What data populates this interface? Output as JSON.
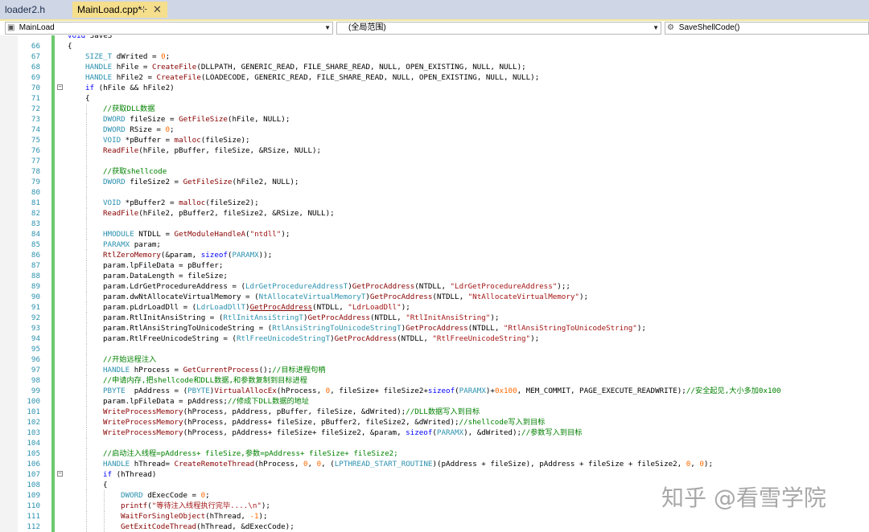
{
  "tabs": {
    "inactive_label": "loader2.h",
    "active_label": "MainLoad.cpp*",
    "pin_icon": "pin-icon",
    "close_icon": "close-icon"
  },
  "nav": {
    "scope_label": "MainLoad",
    "range_label": "(全局范围)",
    "member_label": "SaveShellCode()"
  },
  "colors": {
    "keyword": "#0000ff",
    "type": "#2b91af",
    "function": "#880000",
    "comment": "#008000",
    "string": "#a31515",
    "macro": "#6f008a",
    "number": "#ff6a00",
    "cast": "#2b91af"
  },
  "watermark": "知乎 @看雪学院",
  "lines": [
    {
      "n": "",
      "fold": "",
      "indent": 0,
      "tokens": [
        [
          "k",
          "void"
        ],
        [
          "p",
          " SaveS"
        ]
      ]
    },
    {
      "n": "66",
      "fold": "",
      "indent": 0,
      "tokens": [
        [
          "p",
          "{"
        ]
      ]
    },
    {
      "n": "67",
      "fold": "",
      "indent": 1,
      "tokens": [
        [
          "t",
          "SIZE_T"
        ],
        [
          "p",
          " dWrited = "
        ],
        [
          "num",
          "0"
        ],
        [
          "p",
          ";"
        ]
      ]
    },
    {
      "n": "68",
      "fold": "",
      "indent": 1,
      "tokens": [
        [
          "t",
          "HANDLE"
        ],
        [
          "p",
          " hFile = "
        ],
        [
          "f",
          "CreateFile"
        ],
        [
          "p",
          "(DLLPATH, GENERIC_READ, FILE_SHARE_READ, NULL, OPEN_EXISTING, NULL, NULL);"
        ]
      ]
    },
    {
      "n": "69",
      "fold": "",
      "indent": 1,
      "tokens": [
        [
          "t",
          "HANDLE"
        ],
        [
          "p",
          " hFile2 = "
        ],
        [
          "f",
          "CreateFile"
        ],
        [
          "p",
          "(LOADECODE, GENERIC_READ, FILE_SHARE_READ, NULL, OPEN_EXISTING, NULL, NULL);"
        ]
      ]
    },
    {
      "n": "70",
      "fold": "−",
      "indent": 1,
      "tokens": [
        [
          "k",
          "if"
        ],
        [
          "p",
          " (hFile && hFile2)"
        ]
      ]
    },
    {
      "n": "71",
      "fold": "",
      "indent": 1,
      "tokens": [
        [
          "p",
          "{"
        ]
      ]
    },
    {
      "n": "72",
      "fold": "",
      "indent": 2,
      "tokens": [
        [
          "c",
          "//获取DLL数据"
        ]
      ]
    },
    {
      "n": "73",
      "fold": "",
      "indent": 2,
      "tokens": [
        [
          "t",
          "DWORD"
        ],
        [
          "p",
          " fileSize = "
        ],
        [
          "f",
          "GetFileSize"
        ],
        [
          "p",
          "(hFile, NULL);"
        ]
      ]
    },
    {
      "n": "74",
      "fold": "",
      "indent": 2,
      "tokens": [
        [
          "t",
          "DWORD"
        ],
        [
          "p",
          " RSize = "
        ],
        [
          "num",
          "0"
        ],
        [
          "p",
          ";"
        ]
      ]
    },
    {
      "n": "75",
      "fold": "",
      "indent": 2,
      "tokens": [
        [
          "t",
          "VOID"
        ],
        [
          "p",
          " *pBuffer = "
        ],
        [
          "f",
          "malloc"
        ],
        [
          "p",
          "(fileSize);"
        ]
      ]
    },
    {
      "n": "76",
      "fold": "",
      "indent": 2,
      "tokens": [
        [
          "f",
          "ReadFile"
        ],
        [
          "p",
          "(hFile, pBuffer, fileSize, &RSize, NULL);"
        ]
      ]
    },
    {
      "n": "77",
      "fold": "",
      "indent": 2,
      "tokens": []
    },
    {
      "n": "78",
      "fold": "",
      "indent": 2,
      "tokens": [
        [
          "c",
          "//获取shellcode"
        ]
      ]
    },
    {
      "n": "79",
      "fold": "",
      "indent": 2,
      "tokens": [
        [
          "t",
          "DWORD"
        ],
        [
          "p",
          " fileSize2 = "
        ],
        [
          "f",
          "GetFileSize"
        ],
        [
          "p",
          "(hFile2, NULL);"
        ]
      ]
    },
    {
      "n": "80",
      "fold": "",
      "indent": 2,
      "tokens": []
    },
    {
      "n": "81",
      "fold": "",
      "indent": 2,
      "tokens": [
        [
          "t",
          "VOID"
        ],
        [
          "p",
          " *pBuffer2 = "
        ],
        [
          "f",
          "malloc"
        ],
        [
          "p",
          "(fileSize2);"
        ]
      ]
    },
    {
      "n": "82",
      "fold": "",
      "indent": 2,
      "tokens": [
        [
          "f",
          "ReadFile"
        ],
        [
          "p",
          "(hFile2, pBuffer2, fileSize2, &RSize, NULL);"
        ]
      ]
    },
    {
      "n": "83",
      "fold": "",
      "indent": 2,
      "tokens": []
    },
    {
      "n": "84",
      "fold": "",
      "indent": 2,
      "tokens": [
        [
          "t",
          "HMODULE"
        ],
        [
          "p",
          " NTDLL = "
        ],
        [
          "f",
          "GetModuleHandleA"
        ],
        [
          "p",
          "("
        ],
        [
          "s",
          "\"ntdll\""
        ],
        [
          "p",
          ");"
        ]
      ]
    },
    {
      "n": "85",
      "fold": "",
      "indent": 2,
      "tokens": [
        [
          "t",
          "PARAMX"
        ],
        [
          "p",
          " param;"
        ]
      ]
    },
    {
      "n": "86",
      "fold": "",
      "indent": 2,
      "tokens": [
        [
          "f",
          "RtlZeroMemory"
        ],
        [
          "p",
          "(&param, "
        ],
        [
          "k",
          "sizeof"
        ],
        [
          "p",
          "("
        ],
        [
          "t",
          "PARAMX"
        ],
        [
          "p",
          "));"
        ]
      ]
    },
    {
      "n": "87",
      "fold": "",
      "indent": 2,
      "tokens": [
        [
          "p",
          "param.lpFileData = pBuffer;"
        ]
      ]
    },
    {
      "n": "88",
      "fold": "",
      "indent": 2,
      "tokens": [
        [
          "p",
          "param.DataLength = fileSize;"
        ]
      ]
    },
    {
      "n": "89",
      "fold": "",
      "indent": 2,
      "tokens": [
        [
          "p",
          "param.LdrGetProcedureAddress = ("
        ],
        [
          "t",
          "LdrGetProcedureAddressT"
        ],
        [
          "p",
          ")"
        ],
        [
          "f",
          "GetProcAddress"
        ],
        [
          "p",
          "(NTDLL, "
        ],
        [
          "s",
          "\"LdrGetProcedureAddress\""
        ],
        [
          "p",
          ");;"
        ]
      ]
    },
    {
      "n": "90",
      "fold": "",
      "indent": 2,
      "tokens": [
        [
          "p",
          "param.dwNtAllocateVirtualMemory = ("
        ],
        [
          "t",
          "NtAllocateVirtualMemoryT"
        ],
        [
          "p",
          ")"
        ],
        [
          "f",
          "GetProcAddress"
        ],
        [
          "p",
          "(NTDLL, "
        ],
        [
          "s",
          "\"NtAllocateVirtualMemory\""
        ],
        [
          "p",
          ");"
        ]
      ]
    },
    {
      "n": "91",
      "fold": "",
      "indent": 2,
      "tokens": [
        [
          "p",
          "param.pLdrLoadDll = ("
        ],
        [
          "t",
          "LdrLoadDllT"
        ],
        [
          "p",
          ")"
        ],
        [
          "u",
          "GetProcAddress"
        ],
        [
          "p",
          "(NTDLL, "
        ],
        [
          "s",
          "\"LdrLoadDll\""
        ],
        [
          "p",
          ");"
        ]
      ]
    },
    {
      "n": "92",
      "fold": "",
      "indent": 2,
      "tokens": [
        [
          "p",
          "param.RtlInitAnsiString = ("
        ],
        [
          "t",
          "RtlInitAnsiStringT"
        ],
        [
          "p",
          ")"
        ],
        [
          "f",
          "GetProcAddress"
        ],
        [
          "p",
          "(NTDLL, "
        ],
        [
          "s",
          "\"RtlInitAnsiString\""
        ],
        [
          "p",
          ");"
        ]
      ]
    },
    {
      "n": "93",
      "fold": "",
      "indent": 2,
      "tokens": [
        [
          "p",
          "param.RtlAnsiStringToUnicodeString = ("
        ],
        [
          "t",
          "RtlAnsiStringToUnicodeStringT"
        ],
        [
          "p",
          ")"
        ],
        [
          "f",
          "GetProcAddress"
        ],
        [
          "p",
          "(NTDLL, "
        ],
        [
          "s",
          "\"RtlAnsiStringToUnicodeString\""
        ],
        [
          "p",
          ");"
        ]
      ]
    },
    {
      "n": "94",
      "fold": "",
      "indent": 2,
      "tokens": [
        [
          "p",
          "param.RtlFreeUnicodeString = ("
        ],
        [
          "t",
          "RtlFreeUnicodeStringT"
        ],
        [
          "p",
          ")"
        ],
        [
          "f",
          "GetProcAddress"
        ],
        [
          "p",
          "(NTDLL, "
        ],
        [
          "s",
          "\"RtlFreeUnicodeString\""
        ],
        [
          "p",
          ");"
        ]
      ]
    },
    {
      "n": "95",
      "fold": "",
      "indent": 2,
      "tokens": []
    },
    {
      "n": "96",
      "fold": "",
      "indent": 2,
      "tokens": [
        [
          "c",
          "//开始远程注入"
        ]
      ]
    },
    {
      "n": "97",
      "fold": "",
      "indent": 2,
      "tokens": [
        [
          "t",
          "HANDLE"
        ],
        [
          "p",
          " hProcess = "
        ],
        [
          "f",
          "GetCurrentProcess"
        ],
        [
          "p",
          "();"
        ],
        [
          "c",
          "//目标进程句柄"
        ]
      ]
    },
    {
      "n": "98",
      "fold": "",
      "indent": 2,
      "tokens": [
        [
          "c",
          "//申请内存,把shellcode和DLL数据,和参数复制到目标进程"
        ]
      ]
    },
    {
      "n": "99",
      "fold": "",
      "indent": 2,
      "tokens": [
        [
          "t",
          "PBYTE"
        ],
        [
          "p",
          "  pAddress = ("
        ],
        [
          "t",
          "PBYTE"
        ],
        [
          "p",
          ")"
        ],
        [
          "f",
          "VirtualAllocEx"
        ],
        [
          "p",
          "(hProcess, "
        ],
        [
          "num",
          "0"
        ],
        [
          "p",
          ", fileSize+ fileSize2+"
        ],
        [
          "k",
          "sizeof"
        ],
        [
          "p",
          "("
        ],
        [
          "t",
          "PARAMX"
        ],
        [
          "p",
          ")+"
        ],
        [
          "num",
          "0x100"
        ],
        [
          "p",
          ", MEM_COMMIT, PAGE_EXECUTE_READWRITE);"
        ],
        [
          "c",
          "//安全起见,大小多加0x100"
        ]
      ]
    },
    {
      "n": "100",
      "fold": "",
      "indent": 2,
      "tokens": [
        [
          "p",
          "param.lpFileData = pAddress;"
        ],
        [
          "c",
          "//修成下DLL数据的地址"
        ]
      ]
    },
    {
      "n": "101",
      "fold": "",
      "indent": 2,
      "tokens": [
        [
          "f",
          "WriteProcessMemory"
        ],
        [
          "p",
          "(hProcess, pAddress, pBuffer, fileSize, &dWrited);"
        ],
        [
          "c",
          "//DLL数据写入到目标"
        ]
      ]
    },
    {
      "n": "102",
      "fold": "",
      "indent": 2,
      "tokens": [
        [
          "f",
          "WriteProcessMemory"
        ],
        [
          "p",
          "(hProcess, pAddress+ fileSize, pBuffer2, fileSize2, &dWrited);"
        ],
        [
          "c",
          "//shellcode写入到目标"
        ]
      ]
    },
    {
      "n": "103",
      "fold": "",
      "indent": 2,
      "tokens": [
        [
          "f",
          "WriteProcessMemory"
        ],
        [
          "p",
          "(hProcess, pAddress+ fileSize+ fileSize2, &param, "
        ],
        [
          "k",
          "sizeof"
        ],
        [
          "p",
          "("
        ],
        [
          "t",
          "PARAMX"
        ],
        [
          "p",
          "), &dWrited);"
        ],
        [
          "c",
          "//参数写入到目标"
        ]
      ]
    },
    {
      "n": "104",
      "fold": "",
      "indent": 2,
      "tokens": []
    },
    {
      "n": "105",
      "fold": "",
      "indent": 2,
      "tokens": [
        [
          "c",
          "//启动注入线程=pAddress+ fileSize,参数=pAddress+ fileSize+ fileSize2;"
        ]
      ]
    },
    {
      "n": "106",
      "fold": "",
      "indent": 2,
      "tokens": [
        [
          "t",
          "HANDLE"
        ],
        [
          "p",
          " hThread= "
        ],
        [
          "f",
          "CreateRemoteThread"
        ],
        [
          "p",
          "(hProcess, "
        ],
        [
          "num",
          "0"
        ],
        [
          "p",
          ", "
        ],
        [
          "num",
          "0"
        ],
        [
          "p",
          ", ("
        ],
        [
          "t",
          "LPTHREAD_START_ROUTINE"
        ],
        [
          "p",
          ")(pAddress + fileSize), pAddress + fileSize + fileSize2, "
        ],
        [
          "num",
          "0"
        ],
        [
          "p",
          ", "
        ],
        [
          "num",
          "0"
        ],
        [
          "p",
          ");"
        ]
      ]
    },
    {
      "n": "107",
      "fold": "−",
      "indent": 2,
      "tokens": [
        [
          "k",
          "if"
        ],
        [
          "p",
          " (hThread)"
        ]
      ]
    },
    {
      "n": "108",
      "fold": "",
      "indent": 2,
      "tokens": [
        [
          "p",
          "{"
        ]
      ]
    },
    {
      "n": "109",
      "fold": "",
      "indent": 3,
      "tokens": [
        [
          "t",
          "DWORD"
        ],
        [
          "p",
          " dExecCode = "
        ],
        [
          "num",
          "0"
        ],
        [
          "p",
          ";"
        ]
      ]
    },
    {
      "n": "110",
      "fold": "",
      "indent": 3,
      "tokens": [
        [
          "f",
          "printf"
        ],
        [
          "p",
          "("
        ],
        [
          "s",
          "\"等待注入线程执行完毕....\\n\""
        ],
        [
          "p",
          ");"
        ]
      ]
    },
    {
      "n": "111",
      "fold": "",
      "indent": 3,
      "tokens": [
        [
          "f",
          "WaitForSingleObject"
        ],
        [
          "p",
          "(hThread, "
        ],
        [
          "num",
          "-1"
        ],
        [
          "p",
          ");"
        ]
      ]
    },
    {
      "n": "112",
      "fold": "",
      "indent": 3,
      "tokens": [
        [
          "f",
          "GetExitCodeThread"
        ],
        [
          "p",
          "(hThread, &dExecCode);"
        ]
      ]
    }
  ]
}
